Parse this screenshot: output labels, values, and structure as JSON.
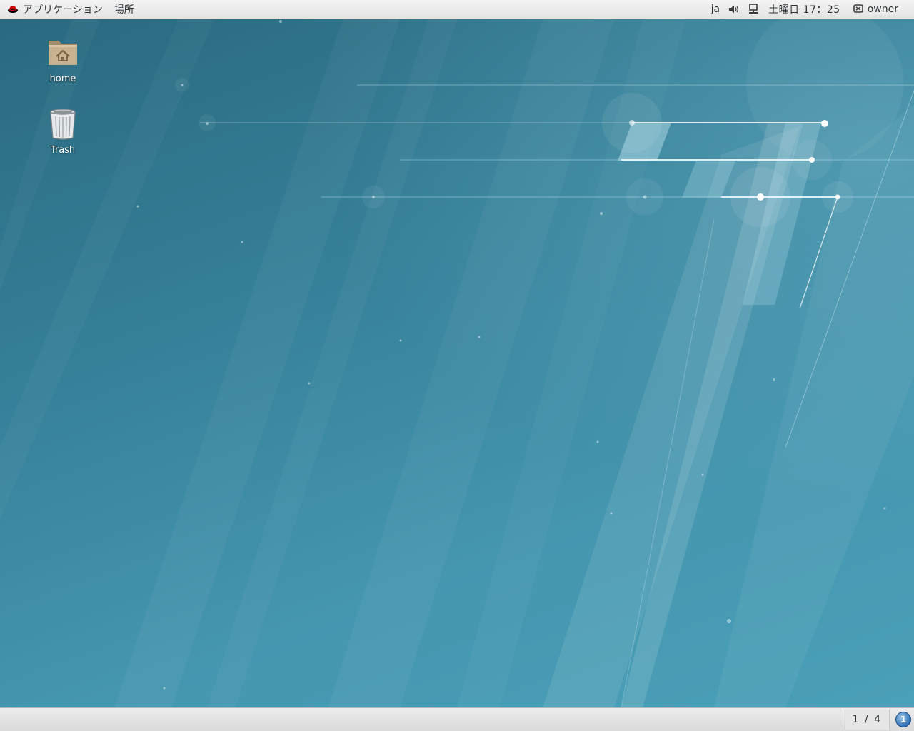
{
  "top_panel": {
    "applications_label": "アプリケーション",
    "places_label": "場所",
    "input_method": "ja",
    "volume_icon": "speaker-icon",
    "network_icon": "network-icon",
    "clock": "土曜日 17：25",
    "user_name": "owner"
  },
  "desktop": {
    "icons": [
      {
        "label": "home",
        "icon": "home-folder-icon"
      },
      {
        "label": "Trash",
        "icon": "trash-icon"
      }
    ]
  },
  "bottom_panel": {
    "workspace_indicator": "1 / 4",
    "notification_count": "1"
  },
  "colors": {
    "panel_bg": "#e6e6e6",
    "wallpaper_dark": "#2a6a80",
    "wallpaper_light": "#4aa0b8",
    "redhat_red": "#cc0000"
  }
}
